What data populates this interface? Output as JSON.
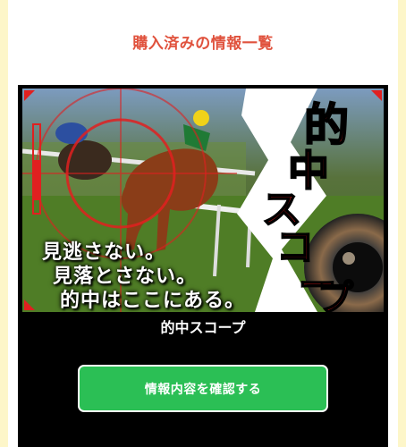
{
  "section": {
    "title": "購入済みの情報一覧"
  },
  "product": {
    "banner_title": "的中スコープ",
    "banner_catch": [
      "見逃さない。",
      "見落とさない。",
      "的中はここにある。"
    ],
    "name": "的中スコープ",
    "button_label": "情報内容を確認する"
  },
  "colors": {
    "title": "#e0523d",
    "button": "#2bbf55",
    "card": "#000000",
    "page_border": "#fdf6c9"
  }
}
